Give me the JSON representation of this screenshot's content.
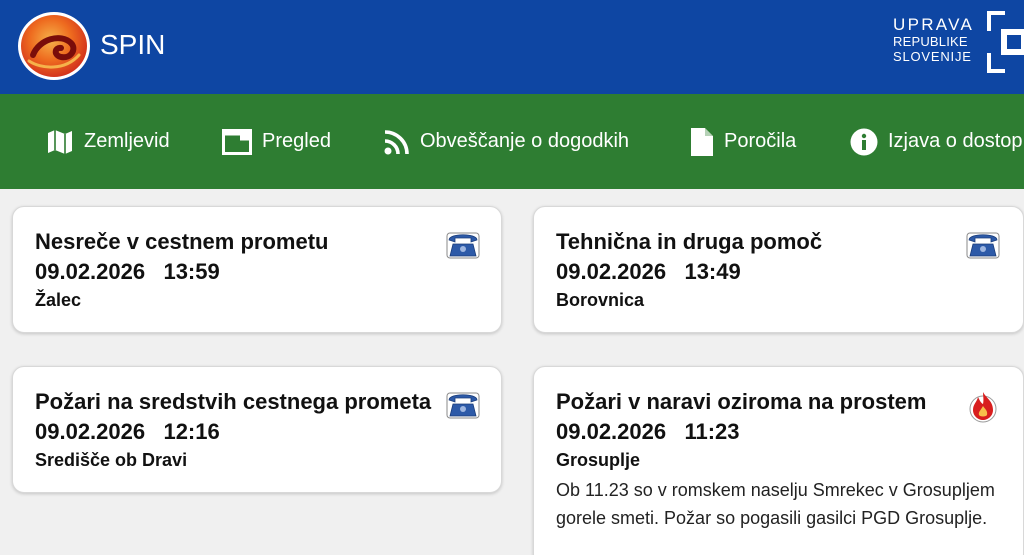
{
  "header": {
    "app_title": "SPIN",
    "gov_logo": {
      "line1": "UPRAVA",
      "line2": "REPUBLIKE",
      "line3": "SLOVENIJE"
    }
  },
  "nav": {
    "items": [
      {
        "label": "Zemljevid",
        "icon": "map-icon"
      },
      {
        "label": "Pregled",
        "icon": "window-icon"
      },
      {
        "label": "Obveščanje o dogodkih",
        "icon": "rss-icon"
      },
      {
        "label": "Poročila",
        "icon": "document-icon"
      },
      {
        "label": "Izjava o dostop",
        "icon": "info-icon"
      }
    ]
  },
  "events": [
    {
      "title": "Nesreče v cestnem prometu",
      "date": "09.02.2026",
      "time": "13:59",
      "location": "Žalec",
      "icon": "telephone-icon"
    },
    {
      "title": "Tehnična in druga pomoč",
      "date": "09.02.2026",
      "time": "13:49",
      "location": "Borovnica",
      "icon": "telephone-icon"
    },
    {
      "title": "Požari na sredstvih cestnega prometa",
      "date": "09.02.2026",
      "time": "12:16",
      "location": "Središče ob Dravi",
      "icon": "telephone-icon"
    },
    {
      "title": "Požari v naravi oziroma na prostem",
      "date": "09.02.2026",
      "time": "11:23",
      "location": "Grosuplje",
      "icon": "fire-icon",
      "description": "Ob 11.23 so v romskem naselju Smrekec v Grosupljem gorele smeti. Požar so pogasili gasilci PGD Grosuplje."
    }
  ],
  "colors": {
    "header_bg": "#0e46a3",
    "nav_bg": "#2e7d32",
    "page_bg": "#f0f0f0",
    "phone_icon": "#2d5aa8",
    "fire_icon": "#d81e1e"
  }
}
